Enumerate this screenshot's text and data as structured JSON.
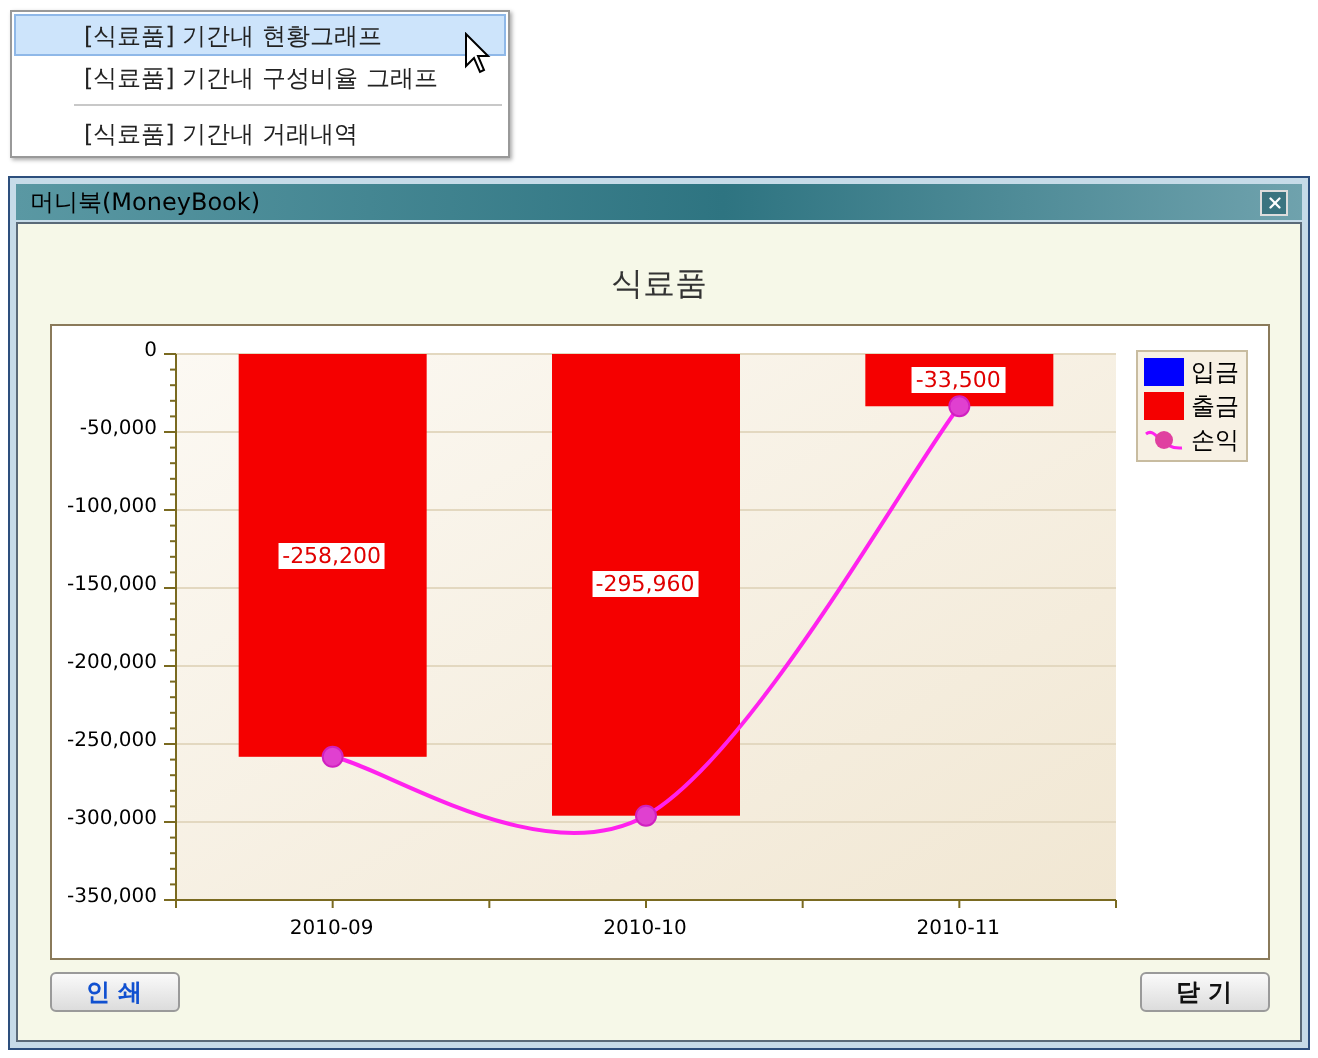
{
  "menu": {
    "items": [
      {
        "label": "[식료품] 기간내 현황그래프",
        "selected": true,
        "separator_before": false
      },
      {
        "label": "[식료품] 기간내 구성비율 그래프",
        "selected": false,
        "separator_before": false
      },
      {
        "label": "[식료품] 기간내 거래내역",
        "selected": false,
        "separator_before": true
      }
    ]
  },
  "window": {
    "title": "머니북(MoneyBook)",
    "chart_data": {
      "type": "bar",
      "title": "식료품",
      "categories": [
        "2010-09",
        "2010-10",
        "2010-11"
      ],
      "series": [
        {
          "name": "입금",
          "type": "bar",
          "color": "#0000ff",
          "values": [
            0,
            0,
            0
          ]
        },
        {
          "name": "출금",
          "type": "bar",
          "color": "#f50000",
          "values": [
            -258200,
            -295960,
            -33500
          ]
        },
        {
          "name": "손익",
          "type": "line",
          "color": "#ff22ee",
          "marker": "circle",
          "values": [
            -258200,
            -295960,
            -33500
          ]
        }
      ],
      "stacked": true,
      "grid": "y",
      "legend": "right",
      "ylim": [
        -350000,
        0
      ],
      "yticks": [
        {
          "value": 0,
          "label": "0"
        },
        {
          "value": -50000,
          "label": "-50,000"
        },
        {
          "value": -100000,
          "label": "-100,000"
        },
        {
          "value": -150000,
          "label": "-150,000"
        },
        {
          "value": -200000,
          "label": "-200,000"
        },
        {
          "value": -250000,
          "label": "-250,000"
        },
        {
          "value": -300000,
          "label": "-300,000"
        },
        {
          "value": -350000,
          "label": "-350,000"
        }
      ],
      "value_labels": [
        "-258,200",
        "-295,960",
        "-33,500"
      ]
    },
    "buttons": [
      {
        "label": "인 쇄",
        "color": "#1050d0"
      },
      {
        "label": "닫 기",
        "color": "#111111"
      }
    ]
  }
}
